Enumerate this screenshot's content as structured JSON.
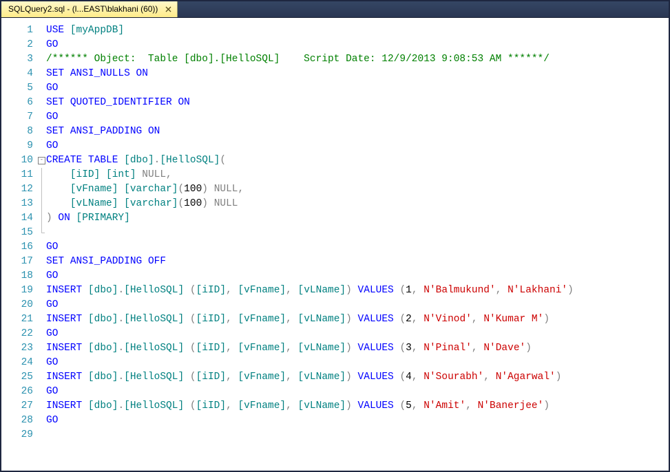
{
  "tab": {
    "title": "SQLQuery2.sql - (l...EAST\\blakhani (60))",
    "close_tooltip": "Close"
  },
  "code_lines": [
    {
      "n": 1,
      "fold": "",
      "html": "<span class='kw'>USE</span> <span class='id'>[myAppDB]</span>"
    },
    {
      "n": 2,
      "fold": "",
      "html": "<span class='kw'>GO</span>"
    },
    {
      "n": 3,
      "fold": "",
      "html": "<span class='cmt'>/****** Object:  Table [dbo].[HelloSQL]    Script Date: 12/9/2013 9:08:53 AM ******/</span>"
    },
    {
      "n": 4,
      "fold": "",
      "html": "<span class='kw'>SET</span> <span class='kw'>ANSI_NULLS</span> <span class='kw'>ON</span>"
    },
    {
      "n": 5,
      "fold": "",
      "html": "<span class='kw'>GO</span>"
    },
    {
      "n": 6,
      "fold": "",
      "html": "<span class='kw'>SET</span> <span class='kw'>QUOTED_IDENTIFIER</span> <span class='kw'>ON</span>"
    },
    {
      "n": 7,
      "fold": "",
      "html": "<span class='kw'>GO</span>"
    },
    {
      "n": 8,
      "fold": "",
      "html": "<span class='kw'>SET</span> <span class='kw'>ANSI_PADDING</span> <span class='kw'>ON</span>"
    },
    {
      "n": 9,
      "fold": "",
      "html": "<span class='kw'>GO</span>"
    },
    {
      "n": 10,
      "fold": "start",
      "html": "<span class='kw'>CREATE</span> <span class='kw'>TABLE</span> <span class='id'>[dbo]</span><span class='gry'>.</span><span class='id'>[HelloSQL]</span><span class='gry'>(</span>"
    },
    {
      "n": 11,
      "fold": "mid",
      "html": "    <span class='id'>[iID]</span> <span class='id'>[int]</span> <span class='gry'>NULL,</span>"
    },
    {
      "n": 12,
      "fold": "mid",
      "html": "    <span class='id'>[vFname]</span> <span class='id'>[varchar]</span><span class='gry'>(</span><span class='blk'>100</span><span class='gry'>)</span> <span class='gry'>NULL,</span>"
    },
    {
      "n": 13,
      "fold": "mid",
      "html": "    <span class='id'>[vLName]</span> <span class='id'>[varchar]</span><span class='gry'>(</span><span class='blk'>100</span><span class='gry'>)</span> <span class='gry'>NULL</span>"
    },
    {
      "n": 14,
      "fold": "mid",
      "html": "<span class='gry'>)</span> <span class='kw'>ON</span> <span class='id'>[PRIMARY]</span>"
    },
    {
      "n": 15,
      "fold": "end",
      "html": ""
    },
    {
      "n": 16,
      "fold": "",
      "html": "<span class='kw'>GO</span>"
    },
    {
      "n": 17,
      "fold": "",
      "html": "<span class='kw'>SET</span> <span class='kw'>ANSI_PADDING</span> <span class='kw'>OFF</span>"
    },
    {
      "n": 18,
      "fold": "",
      "html": "<span class='kw'>GO</span>"
    },
    {
      "n": 19,
      "fold": "",
      "html": "<span class='kw'>INSERT</span> <span class='id'>[dbo]</span><span class='gry'>.</span><span class='id'>[HelloSQL]</span> <span class='gry'>(</span><span class='id'>[iID]</span><span class='gry'>,</span> <span class='id'>[vFname]</span><span class='gry'>,</span> <span class='id'>[vLName]</span><span class='gry'>)</span> <span class='kw'>VALUES</span> <span class='gry'>(</span><span class='blk'>1</span><span class='gry'>,</span> <span class='str'>N'Balmukund'</span><span class='gry'>,</span> <span class='str'>N'Lakhani'</span><span class='gry'>)</span>"
    },
    {
      "n": 20,
      "fold": "",
      "html": "<span class='kw'>GO</span>"
    },
    {
      "n": 21,
      "fold": "",
      "html": "<span class='kw'>INSERT</span> <span class='id'>[dbo]</span><span class='gry'>.</span><span class='id'>[HelloSQL]</span> <span class='gry'>(</span><span class='id'>[iID]</span><span class='gry'>,</span> <span class='id'>[vFname]</span><span class='gry'>,</span> <span class='id'>[vLName]</span><span class='gry'>)</span> <span class='kw'>VALUES</span> <span class='gry'>(</span><span class='blk'>2</span><span class='gry'>,</span> <span class='str'>N'Vinod'</span><span class='gry'>,</span> <span class='str'>N'Kumar M'</span><span class='gry'>)</span>"
    },
    {
      "n": 22,
      "fold": "",
      "html": "<span class='kw'>GO</span>"
    },
    {
      "n": 23,
      "fold": "",
      "html": "<span class='kw'>INSERT</span> <span class='id'>[dbo]</span><span class='gry'>.</span><span class='id'>[HelloSQL]</span> <span class='gry'>(</span><span class='id'>[iID]</span><span class='gry'>,</span> <span class='id'>[vFname]</span><span class='gry'>,</span> <span class='id'>[vLName]</span><span class='gry'>)</span> <span class='kw'>VALUES</span> <span class='gry'>(</span><span class='blk'>3</span><span class='gry'>,</span> <span class='str'>N'Pinal'</span><span class='gry'>,</span> <span class='str'>N'Dave'</span><span class='gry'>)</span>"
    },
    {
      "n": 24,
      "fold": "",
      "html": "<span class='kw'>GO</span>"
    },
    {
      "n": 25,
      "fold": "",
      "html": "<span class='kw'>INSERT</span> <span class='id'>[dbo]</span><span class='gry'>.</span><span class='id'>[HelloSQL]</span> <span class='gry'>(</span><span class='id'>[iID]</span><span class='gry'>,</span> <span class='id'>[vFname]</span><span class='gry'>,</span> <span class='id'>[vLName]</span><span class='gry'>)</span> <span class='kw'>VALUES</span> <span class='gry'>(</span><span class='blk'>4</span><span class='gry'>,</span> <span class='str'>N'Sourabh'</span><span class='gry'>,</span> <span class='str'>N'Agarwal'</span><span class='gry'>)</span>"
    },
    {
      "n": 26,
      "fold": "",
      "html": "<span class='kw'>GO</span>"
    },
    {
      "n": 27,
      "fold": "",
      "html": "<span class='kw'>INSERT</span> <span class='id'>[dbo]</span><span class='gry'>.</span><span class='id'>[HelloSQL]</span> <span class='gry'>(</span><span class='id'>[iID]</span><span class='gry'>,</span> <span class='id'>[vFname]</span><span class='gry'>,</span> <span class='id'>[vLName]</span><span class='gry'>)</span> <span class='kw'>VALUES</span> <span class='gry'>(</span><span class='blk'>5</span><span class='gry'>,</span> <span class='str'>N'Amit'</span><span class='gry'>,</span> <span class='str'>N'Banerjee'</span><span class='gry'>)</span>"
    },
    {
      "n": 28,
      "fold": "",
      "html": "<span class='kw'>GO</span>"
    },
    {
      "n": 29,
      "fold": "",
      "html": ""
    }
  ]
}
